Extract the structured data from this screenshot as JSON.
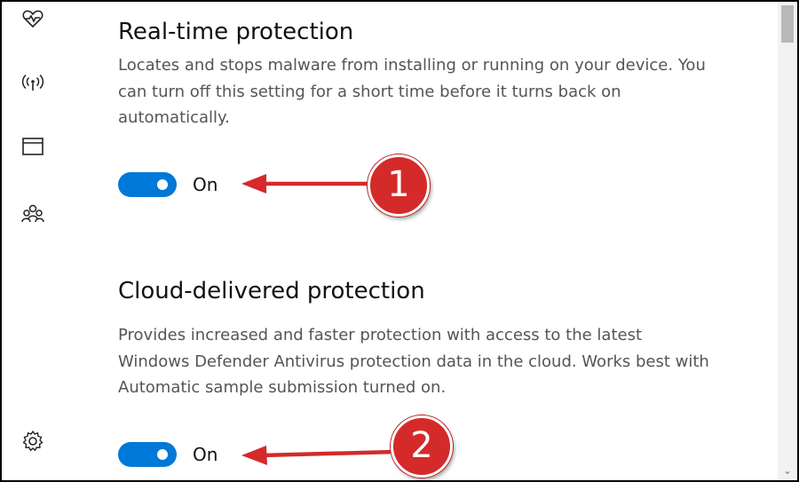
{
  "nav": {
    "icons": [
      "heart-pulse-icon",
      "wireless-signal-icon",
      "app-browser-icon",
      "family-icon",
      "settings-gear-icon"
    ]
  },
  "sections": [
    {
      "title": "Real-time protection",
      "desc_lines": [
        "Locates and stops malware from installing or running on your device. You",
        "can turn off this setting for a short time before it turns back on",
        "automatically."
      ],
      "toggle_state": "On",
      "annotation": "1"
    },
    {
      "title": "Cloud-delivered protection",
      "desc_lines": [
        "Provides increased and faster protection with access to the latest",
        "Windows Defender Antivirus protection data in the cloud. Works best with",
        "Automatic sample submission turned on."
      ],
      "toggle_state": "On",
      "annotation": "2"
    }
  ],
  "colors": {
    "accent": "#0078d7",
    "annotation_red": "#d42a2a"
  },
  "scrollbar": {
    "down_arrow": "⌄"
  }
}
